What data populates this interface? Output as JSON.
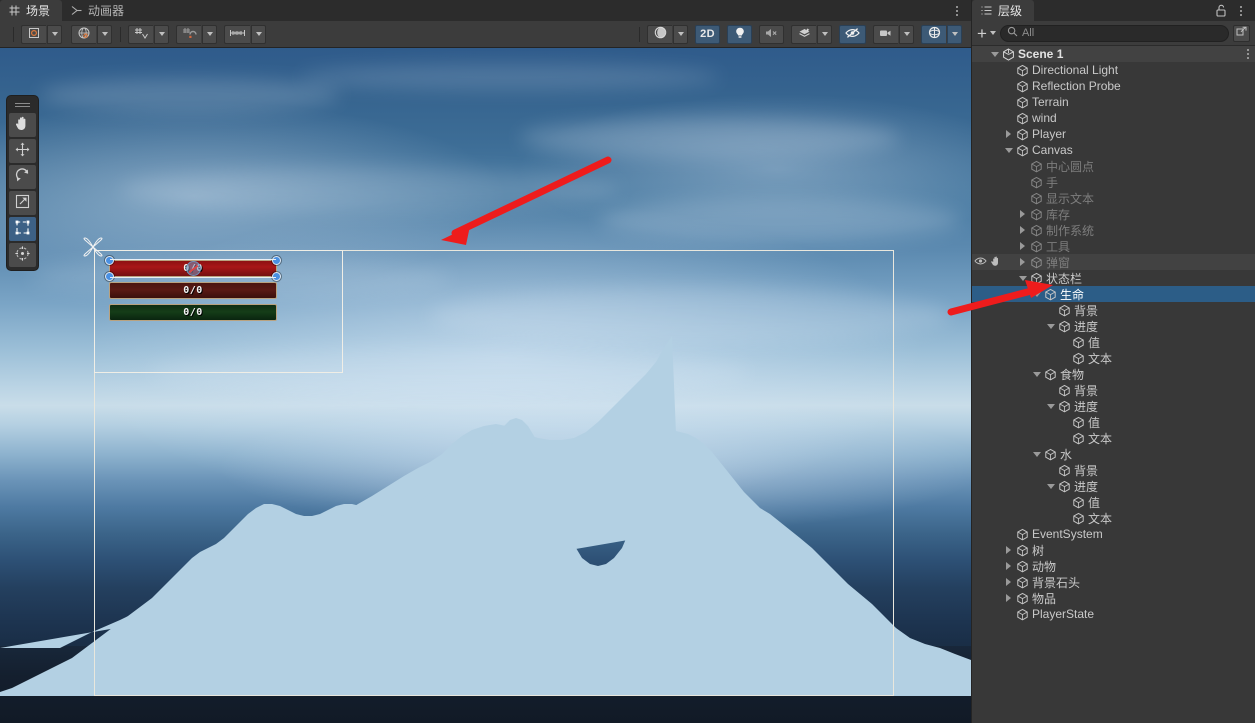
{
  "scene_panel": {
    "tabs": [
      {
        "label": "场景",
        "icon": "grid-icon",
        "active": true
      },
      {
        "label": "动画器",
        "icon": "animator-icon",
        "active": false
      }
    ],
    "menu_icon": "kebab-menu-icon",
    "toolbar_left": [
      {
        "name": "pivot-toggle",
        "icon": "pivot-icon",
        "has_dropdown": true,
        "active": false
      },
      {
        "name": "handle-space-toggle",
        "icon": "globe-icon",
        "has_dropdown": true,
        "active": false
      },
      {
        "name": "grid-snap-toggle",
        "icon": "grid-snap-icon",
        "has_dropdown": true,
        "active": false
      },
      {
        "name": "grid-visibility-toggle",
        "icon": "grid-magnet-icon",
        "has_dropdown": true,
        "active": false
      },
      {
        "name": "ruler-toggle",
        "icon": "ruler-icon",
        "has_dropdown": true,
        "active": false
      }
    ],
    "toolbar_right": [
      {
        "name": "draw-mode-dropdown",
        "icon": "shaded-sphere-icon",
        "label": "",
        "has_dropdown": true,
        "active": false
      },
      {
        "name": "2d-toggle",
        "icon": "",
        "label": "2D",
        "has_dropdown": false,
        "active": true
      },
      {
        "name": "lighting-toggle",
        "icon": "lightbulb-icon",
        "label": "",
        "has_dropdown": false,
        "active": true
      },
      {
        "name": "audio-toggle",
        "icon": "audio-mute-icon",
        "label": "",
        "has_dropdown": false,
        "active": false
      },
      {
        "name": "effects-toggle",
        "icon": "effects-icon",
        "label": "",
        "has_dropdown": true,
        "active": false
      },
      {
        "name": "hidden-objects-toggle",
        "icon": "eye-slash-icon",
        "label": "",
        "has_dropdown": false,
        "active": true
      },
      {
        "name": "camera-settings",
        "icon": "camera-icon",
        "label": "",
        "has_dropdown": true,
        "active": false
      },
      {
        "name": "gizmos-toggle",
        "icon": "gizmo-globe-icon",
        "label": "",
        "has_dropdown": true,
        "active": true
      }
    ],
    "tools": [
      {
        "name": "hand-tool",
        "icon": "hand-icon",
        "active": false
      },
      {
        "name": "move-tool",
        "icon": "move-arrows-icon",
        "active": false
      },
      {
        "name": "rotate-tool",
        "icon": "rotate-icon",
        "active": false
      },
      {
        "name": "scale-tool",
        "icon": "scale-icon",
        "active": false
      },
      {
        "name": "rect-tool",
        "icon": "rect-transform-icon",
        "active": true
      },
      {
        "name": "transform-tool",
        "icon": "transform-icon",
        "active": false
      }
    ],
    "status_bars": [
      {
        "name": "health-bar",
        "value": "0/0",
        "color": "#a81617",
        "selected": true
      },
      {
        "name": "food-bar",
        "value": "0/0",
        "color": "#5a1a14",
        "selected": false
      },
      {
        "name": "water-bar",
        "value": "0/0",
        "color": "#153d18",
        "selected": false
      }
    ],
    "annotation_color": "#ee1c1c"
  },
  "hierarchy": {
    "tab_label": "层级",
    "tab_icon": "hierarchy-icon",
    "lock_icon": "unlock-icon",
    "menu_icon": "kebab-menu-icon",
    "add_label": "+",
    "search_placeholder": "All",
    "search_icon": "search-icon",
    "popout_icon": "popout-window-icon",
    "scene_name": "Scene 1",
    "scene_icon": "unity-logo-icon",
    "items": [
      {
        "label": "Directional Light",
        "depth": 1,
        "twisty": "none",
        "state": "normal"
      },
      {
        "label": "Reflection Probe",
        "depth": 1,
        "twisty": "none",
        "state": "normal"
      },
      {
        "label": "Terrain",
        "depth": 1,
        "twisty": "none",
        "state": "normal"
      },
      {
        "label": "wind",
        "depth": 1,
        "twisty": "none",
        "state": "normal"
      },
      {
        "label": "Player",
        "depth": 1,
        "twisty": "collapsed",
        "state": "normal"
      },
      {
        "label": "Canvas",
        "depth": 1,
        "twisty": "expanded",
        "state": "normal"
      },
      {
        "label": "中心圆点",
        "depth": 2,
        "twisty": "none",
        "state": "dim"
      },
      {
        "label": "手",
        "depth": 2,
        "twisty": "none",
        "state": "dim"
      },
      {
        "label": "显示文本",
        "depth": 2,
        "twisty": "none",
        "state": "dim"
      },
      {
        "label": "库存",
        "depth": 2,
        "twisty": "collapsed",
        "state": "dim"
      },
      {
        "label": "制作系统",
        "depth": 2,
        "twisty": "collapsed",
        "state": "dim"
      },
      {
        "label": "工具",
        "depth": 2,
        "twisty": "collapsed",
        "state": "dim"
      },
      {
        "label": "弹窗",
        "depth": 2,
        "twisty": "collapsed",
        "state": "dim-hover"
      },
      {
        "label": "状态栏",
        "depth": 2,
        "twisty": "expanded",
        "state": "normal"
      },
      {
        "label": "生命",
        "depth": 3,
        "twisty": "expanded",
        "state": "selected"
      },
      {
        "label": "背景",
        "depth": 4,
        "twisty": "none",
        "state": "normal"
      },
      {
        "label": "进度",
        "depth": 4,
        "twisty": "expanded",
        "state": "normal"
      },
      {
        "label": "值",
        "depth": 5,
        "twisty": "none",
        "state": "normal"
      },
      {
        "label": "文本",
        "depth": 5,
        "twisty": "none",
        "state": "normal"
      },
      {
        "label": "食物",
        "depth": 3,
        "twisty": "expanded",
        "state": "normal"
      },
      {
        "label": "背景",
        "depth": 4,
        "twisty": "none",
        "state": "normal"
      },
      {
        "label": "进度",
        "depth": 4,
        "twisty": "expanded",
        "state": "normal"
      },
      {
        "label": "值",
        "depth": 5,
        "twisty": "none",
        "state": "normal"
      },
      {
        "label": "文本",
        "depth": 5,
        "twisty": "none",
        "state": "normal"
      },
      {
        "label": "水",
        "depth": 3,
        "twisty": "expanded",
        "state": "normal"
      },
      {
        "label": "背景",
        "depth": 4,
        "twisty": "none",
        "state": "normal"
      },
      {
        "label": "进度",
        "depth": 4,
        "twisty": "expanded",
        "state": "normal"
      },
      {
        "label": "值",
        "depth": 5,
        "twisty": "none",
        "state": "normal"
      },
      {
        "label": "文本",
        "depth": 5,
        "twisty": "none",
        "state": "normal"
      },
      {
        "label": "EventSystem",
        "depth": 1,
        "twisty": "none",
        "state": "normal"
      },
      {
        "label": "树",
        "depth": 1,
        "twisty": "collapsed",
        "state": "normal"
      },
      {
        "label": "动物",
        "depth": 1,
        "twisty": "collapsed",
        "state": "normal"
      },
      {
        "label": "背景石头",
        "depth": 1,
        "twisty": "collapsed",
        "state": "normal"
      },
      {
        "label": "物品",
        "depth": 1,
        "twisty": "collapsed",
        "state": "normal"
      },
      {
        "label": "PlayerState",
        "depth": 1,
        "twisty": "none",
        "state": "normal"
      }
    ]
  }
}
